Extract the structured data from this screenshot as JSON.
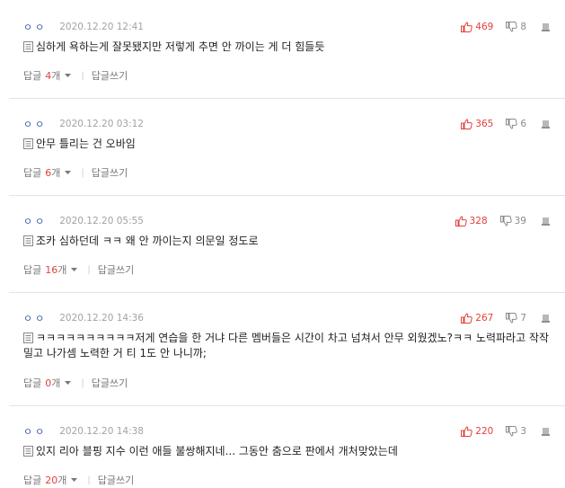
{
  "reply_label": "답글",
  "count_unit": "개",
  "write_reply_label": "답글쓰기",
  "separator": "|",
  "colors": {
    "like": "#e0413b",
    "nick": "#3b5aa8",
    "date": "#a3a3a3"
  },
  "comments": [
    {
      "nickname": "ㅇㅇ",
      "date": "2020.12.20 12:41",
      "likes": "469",
      "dislikes": "8",
      "text": "심하게 욕하는게 잘못됐지만 저렇게 추면 안 까이는 게 더 힘들듯",
      "reply_count": "4"
    },
    {
      "nickname": "ㅇㅇ",
      "date": "2020.12.20 03:12",
      "likes": "365",
      "dislikes": "6",
      "text": "안무 틀리는 건 오바임",
      "reply_count": "6"
    },
    {
      "nickname": "ㅇㅇ",
      "date": "2020.12.20 05:55",
      "likes": "328",
      "dislikes": "39",
      "text": "조카 심하던데 ㅋㅋ 왜 안 까이는지 의문일 정도로",
      "reply_count": "16"
    },
    {
      "nickname": "ㅇㅇ",
      "date": "2020.12.20 14:36",
      "likes": "267",
      "dislikes": "7",
      "text": "ㅋㅋㅋㅋㅋㅋㅋㅋㅋㅋ저게 연습을 한 거냐 다른 멤버들은 시간이 차고 넘쳐서 안무 외웠겠노?ㅋㅋ 노력파라고 작작 밀고 나가셈 노력한 거 티 1도 안 나니까;",
      "reply_count": "0"
    },
    {
      "nickname": "ㅇㅇ",
      "date": "2020.12.20 14:38",
      "likes": "220",
      "dislikes": "3",
      "text": "있지 리아 블핑 지수 이런 애들 불쌍해지네... 그동안 춤으로 판에서 개처맞았는데",
      "reply_count": "20"
    }
  ]
}
